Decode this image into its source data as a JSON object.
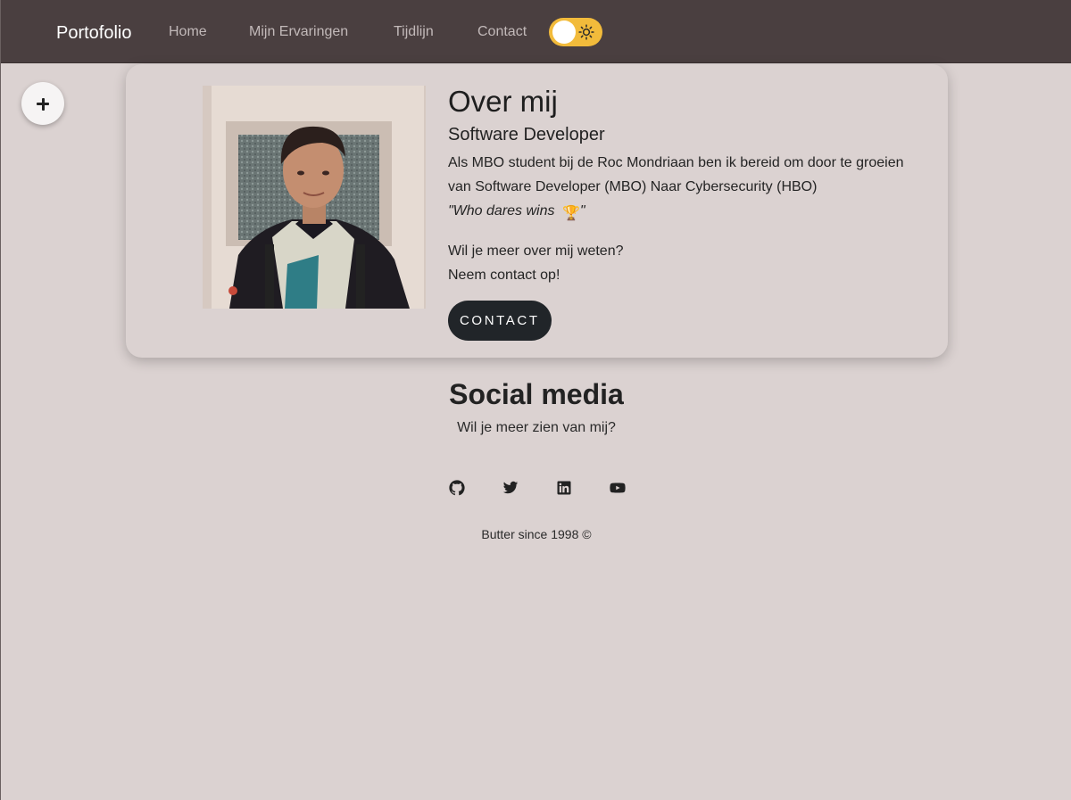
{
  "nav": {
    "brand": "Portofolio",
    "links": [
      "Home",
      "Mijn Ervaringen",
      "Tijdlijn",
      "Contact"
    ],
    "toggle_icon": "sun-icon",
    "toggle_color": "#f2bb3b",
    "background": "#4a3f40"
  },
  "fab": {
    "label": "+"
  },
  "about": {
    "title": "Over mij",
    "subtitle": "Software Developer",
    "description": "Als MBO student bij de Roc Mondriaan ben ik bereid om door te groeien van Software Developer (MBO) Naar Cybersecurity (HBO)",
    "quote_text": "\"Who dares wins ",
    "quote_icon": "🏆",
    "quote_end": "\"",
    "ask_line1": "Wil je meer over mij weten?",
    "ask_line2": "Neem contact op!",
    "button_label": "CONTACT"
  },
  "social": {
    "title": "Social media",
    "subtitle": "Wil je meer zien van mij?",
    "icons": [
      "github-icon",
      "twitter-icon",
      "linkedin-icon",
      "youtube-icon"
    ]
  },
  "footer": {
    "text": "Butter since 1998 ©"
  },
  "colors": {
    "page_background": "#dbd2d1",
    "button_background": "#212529"
  }
}
